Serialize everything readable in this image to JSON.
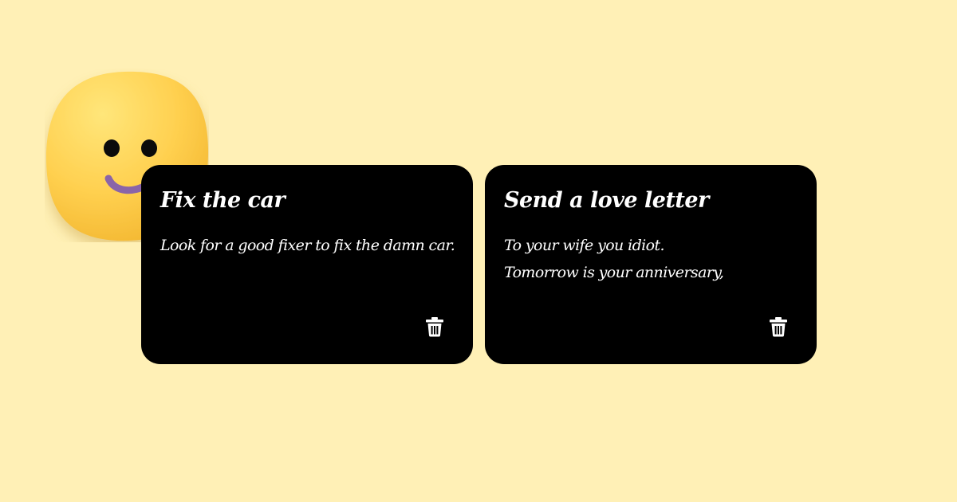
{
  "colors": {
    "background": "#fff0b6",
    "card": "#000000",
    "card_text": "#ffffff",
    "emoji_face": "#ffd457",
    "emoji_mouth": "#8a64a8"
  },
  "mascot": {
    "icon": "smiley-face-icon"
  },
  "notes": [
    {
      "title": "Fix the car",
      "body": [
        "Look for a good fixer to fix the damn car."
      ],
      "delete_icon": "trash-icon"
    },
    {
      "title": "Send a love letter",
      "body": [
        "To your wife you idiot.",
        "Tomorrow is your anniversary,"
      ],
      "delete_icon": "trash-icon"
    }
  ]
}
